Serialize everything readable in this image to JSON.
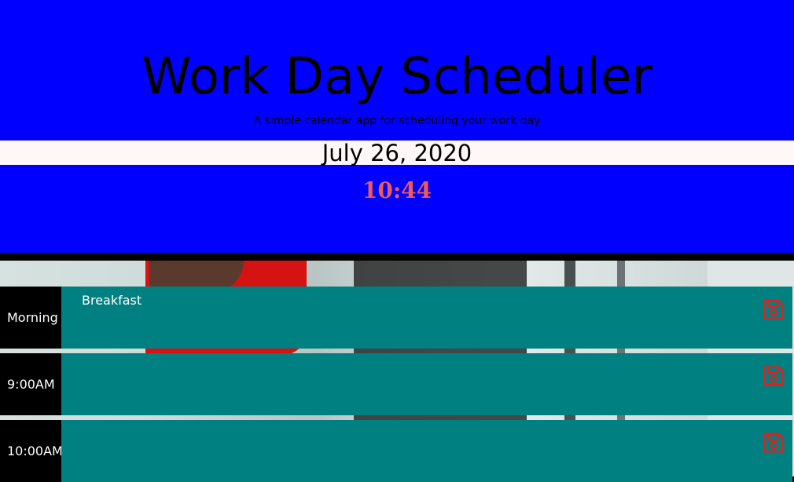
{
  "header": {
    "title": "Work Day Scheduler",
    "subtitle": "A simple calendar app for scheduling your work day",
    "date": "July 26, 2020",
    "clock": "10:44"
  },
  "rows": [
    {
      "hour": "Morning",
      "entry": "Breakfast",
      "save_icon": "floppy-disk-icon"
    },
    {
      "hour": "9:00AM",
      "entry": "",
      "save_icon": "floppy-disk-icon"
    },
    {
      "hour": "10:00AM",
      "entry": "",
      "save_icon": "floppy-disk-icon"
    }
  ],
  "colors": {
    "header_bg": "#0000ff",
    "date_bar_bg": "#fff8f6",
    "clock_color": "#ee5a5a",
    "hour_bg": "#000000",
    "entry_bg": "#008080",
    "save_icon_color": "#e0201e"
  }
}
